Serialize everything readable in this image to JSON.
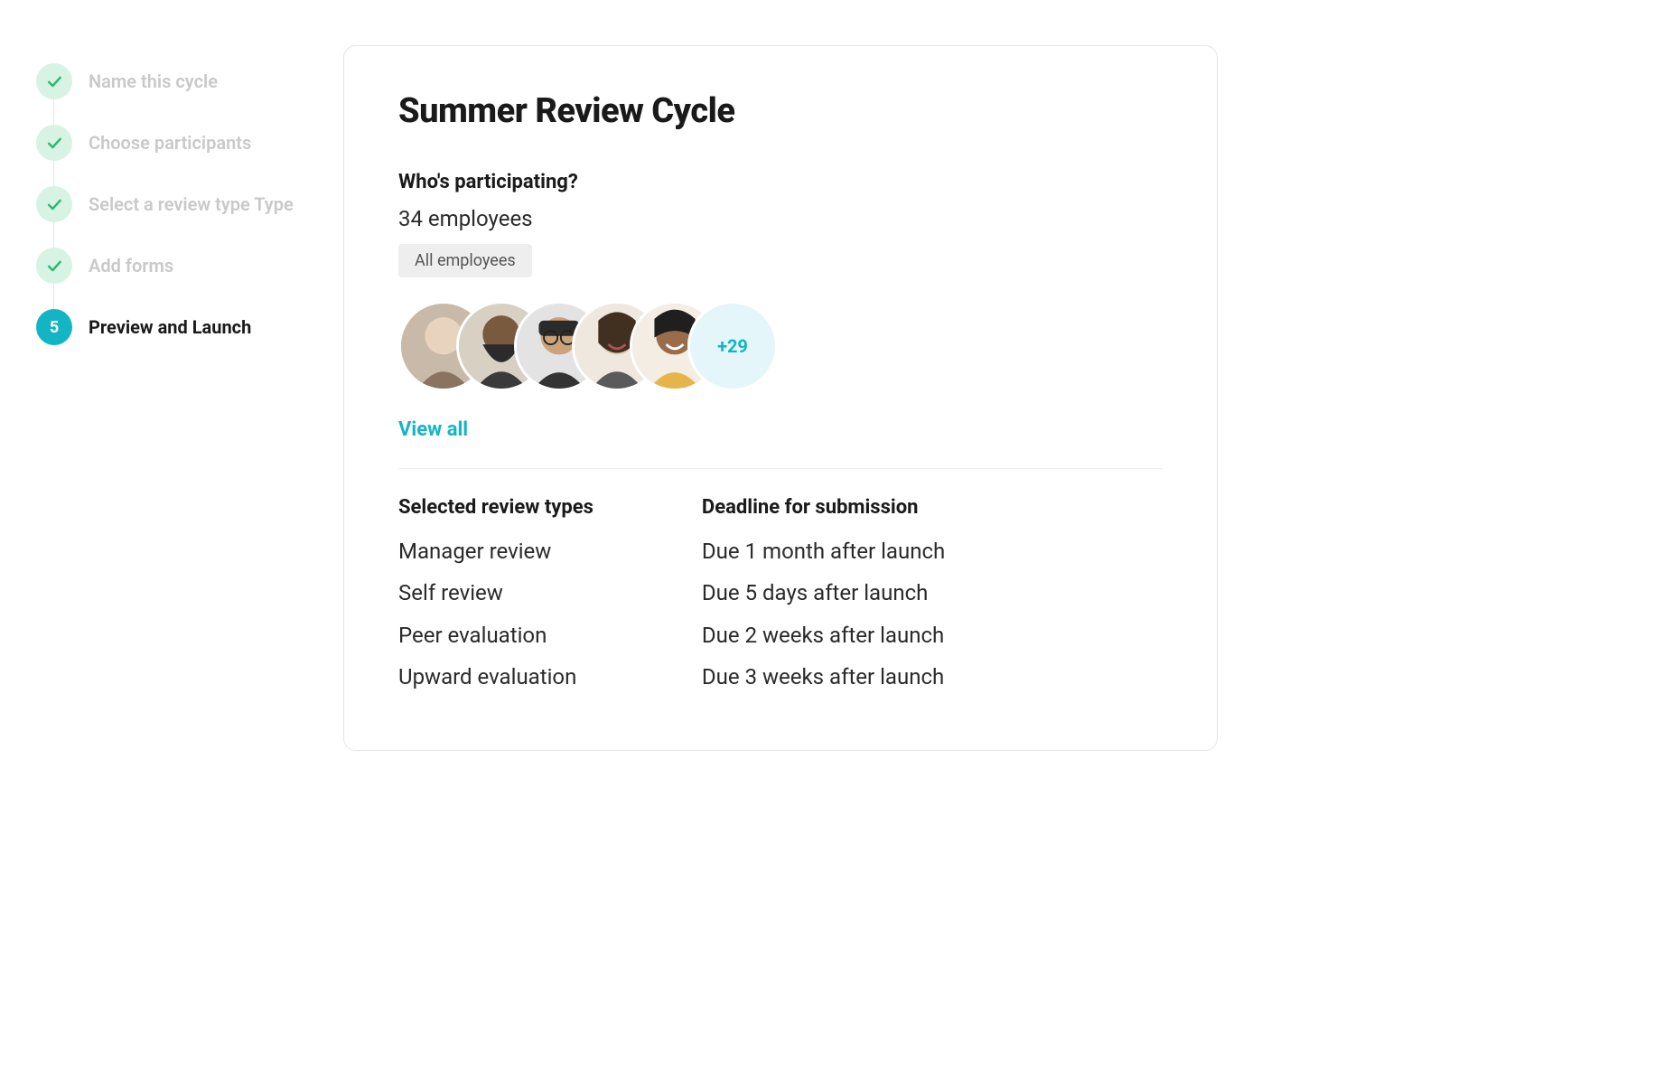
{
  "stepper": {
    "steps": [
      {
        "label": "Name this cycle",
        "state": "done"
      },
      {
        "label": "Choose participants",
        "state": "done"
      },
      {
        "label": "Select a review type Type",
        "state": "done"
      },
      {
        "label": "Add forms",
        "state": "done"
      },
      {
        "label": "Preview and Launch",
        "state": "current",
        "number": "5"
      }
    ]
  },
  "card": {
    "title": "Summer Review Cycle",
    "participating": {
      "heading": "Who's participating?",
      "count_text": "34 employees",
      "chip_label": "All employees",
      "more_count": "+29",
      "view_all": "View all"
    },
    "review_types": {
      "heading": "Selected review types",
      "items": [
        "Manager review",
        "Self review",
        "Peer evaluation",
        "Upward evaluation"
      ]
    },
    "deadlines": {
      "heading": "Deadline for submission",
      "items": [
        "Due 1 month after launch",
        "Due 5 days after launch",
        "Due 2 weeks after launch",
        "Due 3 weeks after launch"
      ]
    }
  },
  "colors": {
    "accent": "#13b5c5",
    "done_bg": "#d6f3e4",
    "done_check": "#2fb873"
  }
}
